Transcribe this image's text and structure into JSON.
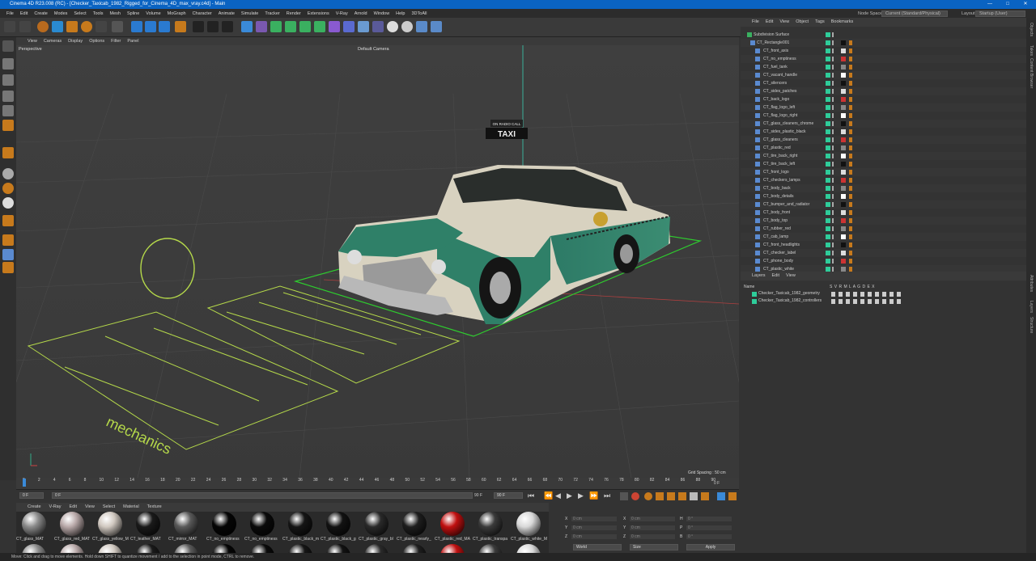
{
  "app": {
    "title": "Cinema 4D R23.008 (RC) - [Checker_Taxicab_1982_Rigged_for_Cinema_4D_max_vray.c4d] - Main"
  },
  "menu": [
    "File",
    "Edit",
    "Create",
    "Modes",
    "Select",
    "Tools",
    "Mesh",
    "Spline",
    "Volume",
    "MoGraph",
    "Character",
    "Animate",
    "Simulate",
    "Tracker",
    "Render",
    "Extensions",
    "V-Ray",
    "Arnold",
    "Window",
    "Help",
    "3DToAll"
  ],
  "node_space": {
    "label": "Node Space:",
    "value": "Current (Standard/Physical)"
  },
  "layout": {
    "label": "Layout:",
    "value": "Startup (User)"
  },
  "viewport": {
    "menu": [
      "View",
      "Cameras",
      "Display",
      "Options",
      "Filter",
      "Panel"
    ],
    "name": "Perspective",
    "camera": "Default Camera",
    "grid_spacing": "Grid Spacing : 50 cm"
  },
  "timeline": {
    "ticks": [
      "0",
      "2",
      "4",
      "6",
      "8",
      "10",
      "12",
      "14",
      "16",
      "18",
      "20",
      "22",
      "24",
      "26",
      "28",
      "30",
      "32",
      "34",
      "36",
      "38",
      "40",
      "42",
      "44",
      "46",
      "48",
      "50",
      "52",
      "54",
      "56",
      "58",
      "60",
      "62",
      "64",
      "66",
      "68",
      "70",
      "72",
      "74",
      "76",
      "78",
      "80",
      "82",
      "84",
      "86",
      "88",
      "90"
    ],
    "current": "0 F"
  },
  "transport": {
    "start": "0 F",
    "field2": "0 F",
    "end": "90 F",
    "end2": "90 F"
  },
  "materials": {
    "menu": [
      "Create",
      "V-Ray",
      "Edit",
      "View",
      "Select",
      "Material",
      "Texture"
    ],
    "items": [
      {
        "name": "CT_glass_MAT",
        "color": "#8a8a8a"
      },
      {
        "name": "CT_glass_red_MAT",
        "color": "#b8a8a8"
      },
      {
        "name": "CT_glass_yellow_M",
        "color": "#d0c8c0"
      },
      {
        "name": "CT_leather_MAT",
        "color": "#1a1a1a"
      },
      {
        "name": "CT_mirror_MAT",
        "color": "#5a5a5a"
      },
      {
        "name": "CT_no_emptiness",
        "color": "#050505"
      },
      {
        "name": "CT_no_emptiness",
        "color": "#0a0a0a"
      },
      {
        "name": "CT_plastic_black_m",
        "color": "#151515"
      },
      {
        "name": "CT_plastic_black_g",
        "color": "#121212"
      },
      {
        "name": "CT_plastic_gray_bl",
        "color": "#2a2a2a"
      },
      {
        "name": "CT_plastic_nearly_",
        "color": "#1e1e1e"
      },
      {
        "name": "CT_plastic_red_MA",
        "color": "#c01010"
      },
      {
        "name": "CT_plastic_transpa",
        "color": "#3a3a3a"
      },
      {
        "name": "CT_plastic_white_M",
        "color": "#d8d8d8"
      }
    ]
  },
  "coords": {
    "rows": [
      [
        "X",
        "0 cm",
        "X",
        "0 cm",
        "H",
        "0 °"
      ],
      [
        "Y",
        "0 cm",
        "Y",
        "0 cm",
        "P",
        "0 °"
      ],
      [
        "Z",
        "0 cm",
        "Z",
        "0 cm",
        "B",
        "0 °"
      ]
    ],
    "mode1": "World",
    "mode2": "Size",
    "apply": "Apply"
  },
  "status": "Move: Click and drag to move elements. Hold down SHIFT to quantize movement / add to the selection in point mode, CTRL to remove.",
  "objects": {
    "menu": [
      "File",
      "Edit",
      "View",
      "Object",
      "Tags",
      "Bookmarks"
    ],
    "items": [
      "Subdivision Surface",
      "CT_Rectangle001",
      "CT_front_axis",
      "CT_no_emptiness",
      "CT_fuel_tank",
      "CT_vacant_handle",
      "CT_silencers",
      "CT_sides_patches",
      "CT_back_logo",
      "CT_flag_logo_left",
      "CT_flag_logo_right",
      "CT_glass_cleaners_chrome",
      "CT_sides_plastic_black",
      "CT_glass_cleaners",
      "CT_plastic_red",
      "CT_tire_back_right",
      "CT_tire_back_left",
      "CT_front_logo",
      "CT_checkers_lamps",
      "CT_body_back",
      "CT_body_details",
      "CT_bumper_and_radiator",
      "CT_body_front",
      "CT_body_top",
      "CT_rubber_red",
      "CT_cab_lamp",
      "CT_front_headlights",
      "CT_checker_label",
      "CT_phone_body",
      "CT_plastic_white"
    ]
  },
  "layers": {
    "menu": [
      "Layers",
      "Edit",
      "View"
    ],
    "header_name": "Name",
    "columns": "S V R M L A G D E X",
    "items": [
      "Checker_Taxicab_1982_geometry",
      "Checker_Taxicab_1982_controllers"
    ]
  },
  "sidetabs": [
    "Objects",
    "Takes",
    "Content Browser",
    "Attributes",
    "Layers",
    "Structure"
  ],
  "scene": {
    "sign_top": "ON RADIO CALL",
    "sign_main": "TAXI",
    "ground_text": "mechanics"
  }
}
